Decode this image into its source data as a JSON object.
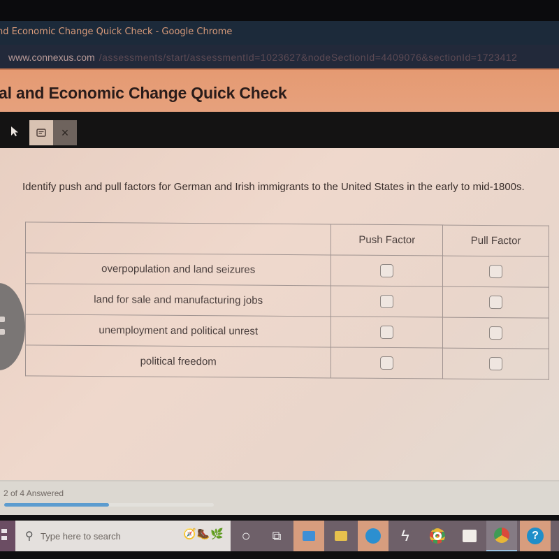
{
  "window": {
    "title": "nd Economic Change Quick Check - Google Chrome",
    "url_domain": "www.connexus.com",
    "url_path": "/assessments/start/assessmentId=1023627&nodeSectionId=4409076&sectionId=1723412"
  },
  "page": {
    "title": "al and Economic Change Quick Check"
  },
  "toolbar": {
    "pointer_icon": "▲",
    "note_icon": "▤",
    "close_icon": "×"
  },
  "question": {
    "prompt": "Identify push and pull factors for German and Irish immigrants to the United States in the early to mid-1800s."
  },
  "table": {
    "columns": [
      "",
      "Push Factor",
      "Pull Factor"
    ],
    "rows": [
      {
        "label": "overpopulation and land seizures",
        "push": false,
        "pull": false
      },
      {
        "label": "land for sale and manufacturing jobs",
        "push": false,
        "pull": false
      },
      {
        "label": "unemployment and political unrest",
        "push": false,
        "pull": false
      },
      {
        "label": "political freedom",
        "push": false,
        "pull": false
      }
    ]
  },
  "progress": {
    "label": "2 of 4 Answered",
    "answered": 2,
    "total": 4,
    "fraction": 0.5
  },
  "taskbar": {
    "search_placeholder": "Type here to search",
    "search_glyph": "⚲",
    "cortana_glyph": "○",
    "taskview_glyph": "⧉",
    "apps": [
      {
        "name": "mail",
        "glyph": "✉"
      },
      {
        "name": "file-explorer",
        "glyph": "▭"
      },
      {
        "name": "edge",
        "glyph": "◉"
      },
      {
        "name": "lightning-app",
        "glyph": "ϟ"
      },
      {
        "name": "chrome",
        "glyph": "◎"
      },
      {
        "name": "microsoft-store",
        "glyph": "▦"
      },
      {
        "name": "chrome-profile",
        "glyph": "◎"
      },
      {
        "name": "help",
        "glyph": "?"
      }
    ]
  },
  "colors": {
    "header_accent": "#e59a72",
    "progress_fill": "#5c9ccf",
    "title_bar": "#1c2a3a"
  }
}
